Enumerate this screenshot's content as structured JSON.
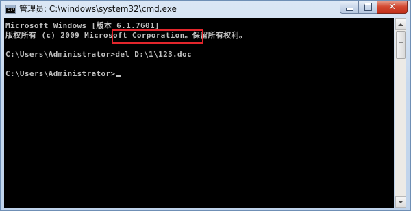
{
  "window": {
    "title": "管理员: C:\\windows\\system32\\cmd.exe",
    "app_icon": "cmd-icon"
  },
  "controls": {
    "minimize_icon": "minimize-icon",
    "maximize_icon": "maximize-icon",
    "close_icon": "close-icon",
    "close_glyph": "✕"
  },
  "console": {
    "lines": [
      "Microsoft Windows [版本 6.1.7601]",
      "版权所有 (c) 2009 Microsoft Corporation。保留所有权利。",
      "",
      "C:\\Users\\Administrator>del D:\\1\\123.doc",
      "",
      "C:\\Users\\Administrator>"
    ],
    "highlighted_command": "del D:\\1\\123.doc",
    "text_color": "#c0c0c0",
    "background_color": "#000000"
  },
  "annotation": {
    "color": "#e3262c"
  }
}
